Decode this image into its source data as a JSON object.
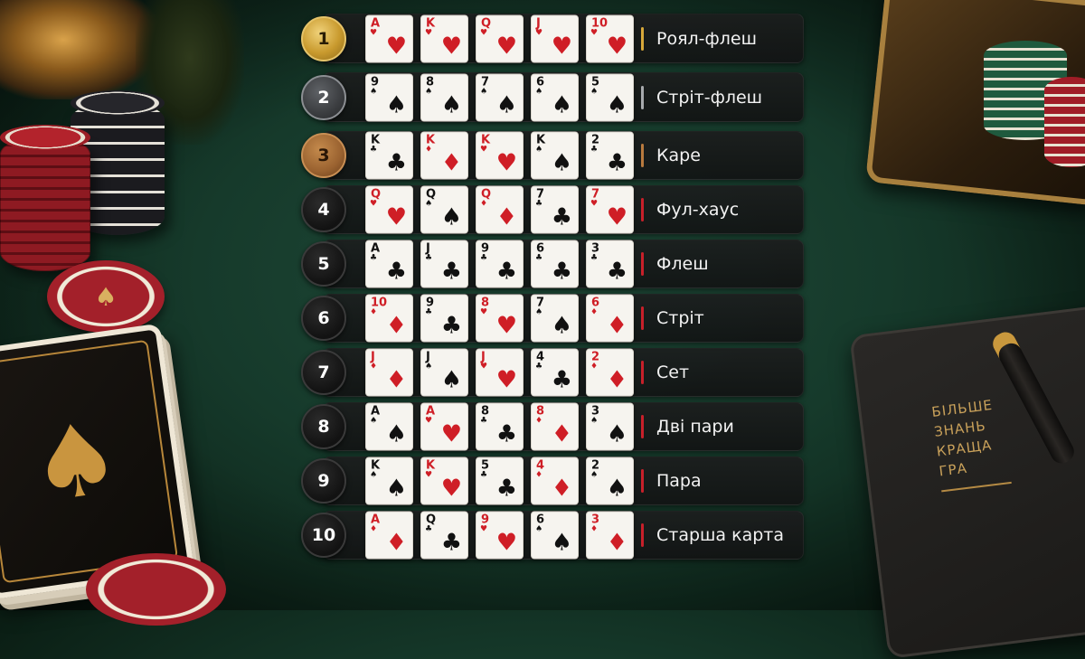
{
  "hands": [
    {
      "rank": "1",
      "medal": "gold",
      "name": "Роял-флеш",
      "cards": [
        {
          "r": "A",
          "s": "♥",
          "c": "red"
        },
        {
          "r": "K",
          "s": "♥",
          "c": "red"
        },
        {
          "r": "Q",
          "s": "♥",
          "c": "red"
        },
        {
          "r": "J",
          "s": "♥",
          "c": "red"
        },
        {
          "r": "10",
          "s": "♥",
          "c": "red"
        }
      ]
    },
    {
      "rank": "2",
      "medal": "silver",
      "name": "Стріт-флеш",
      "cards": [
        {
          "r": "9",
          "s": "♠",
          "c": "black"
        },
        {
          "r": "8",
          "s": "♠",
          "c": "black"
        },
        {
          "r": "7",
          "s": "♠",
          "c": "black"
        },
        {
          "r": "6",
          "s": "♠",
          "c": "black"
        },
        {
          "r": "5",
          "s": "♠",
          "c": "black"
        }
      ]
    },
    {
      "rank": "3",
      "medal": "bronze",
      "name": "Каре",
      "cards": [
        {
          "r": "K",
          "s": "♣",
          "c": "black"
        },
        {
          "r": "K",
          "s": "♦",
          "c": "red"
        },
        {
          "r": "K",
          "s": "♥",
          "c": "red"
        },
        {
          "r": "K",
          "s": "♠",
          "c": "black"
        },
        {
          "r": "2",
          "s": "♣",
          "c": "black"
        }
      ]
    },
    {
      "rank": "4",
      "medal": "",
      "name": "Фул-хаус",
      "cards": [
        {
          "r": "Q",
          "s": "♥",
          "c": "red"
        },
        {
          "r": "Q",
          "s": "♠",
          "c": "black"
        },
        {
          "r": "Q",
          "s": "♦",
          "c": "red"
        },
        {
          "r": "7",
          "s": "♣",
          "c": "black"
        },
        {
          "r": "7",
          "s": "♥",
          "c": "red"
        }
      ]
    },
    {
      "rank": "5",
      "medal": "",
      "name": "Флеш",
      "cards": [
        {
          "r": "A",
          "s": "♣",
          "c": "black"
        },
        {
          "r": "J",
          "s": "♣",
          "c": "black"
        },
        {
          "r": "9",
          "s": "♣",
          "c": "black"
        },
        {
          "r": "6",
          "s": "♣",
          "c": "black"
        },
        {
          "r": "3",
          "s": "♣",
          "c": "black"
        }
      ]
    },
    {
      "rank": "6",
      "medal": "",
      "name": "Стріт",
      "cards": [
        {
          "r": "10",
          "s": "♦",
          "c": "red"
        },
        {
          "r": "9",
          "s": "♣",
          "c": "black"
        },
        {
          "r": "8",
          "s": "♥",
          "c": "red"
        },
        {
          "r": "7",
          "s": "♠",
          "c": "black"
        },
        {
          "r": "6",
          "s": "♦",
          "c": "red"
        }
      ]
    },
    {
      "rank": "7",
      "medal": "",
      "name": "Сет",
      "cards": [
        {
          "r": "J",
          "s": "♦",
          "c": "red"
        },
        {
          "r": "J",
          "s": "♠",
          "c": "black"
        },
        {
          "r": "J",
          "s": "♥",
          "c": "red"
        },
        {
          "r": "4",
          "s": "♣",
          "c": "black"
        },
        {
          "r": "2",
          "s": "♦",
          "c": "red"
        }
      ]
    },
    {
      "rank": "8",
      "medal": "",
      "name": "Дві пари",
      "cards": [
        {
          "r": "A",
          "s": "♠",
          "c": "black"
        },
        {
          "r": "A",
          "s": "♥",
          "c": "red"
        },
        {
          "r": "8",
          "s": "♣",
          "c": "black"
        },
        {
          "r": "8",
          "s": "♦",
          "c": "red"
        },
        {
          "r": "3",
          "s": "♠",
          "c": "black"
        }
      ]
    },
    {
      "rank": "9",
      "medal": "",
      "name": "Пара",
      "cards": [
        {
          "r": "K",
          "s": "♠",
          "c": "black"
        },
        {
          "r": "K",
          "s": "♥",
          "c": "red"
        },
        {
          "r": "5",
          "s": "♣",
          "c": "black"
        },
        {
          "r": "4",
          "s": "♦",
          "c": "red"
        },
        {
          "r": "2",
          "s": "♠",
          "c": "black"
        }
      ]
    },
    {
      "rank": "10",
      "medal": "",
      "name": "Старша карта",
      "cards": [
        {
          "r": "A",
          "s": "♦",
          "c": "red"
        },
        {
          "r": "Q",
          "s": "♣",
          "c": "black"
        },
        {
          "r": "9",
          "s": "♥",
          "c": "red"
        },
        {
          "r": "6",
          "s": "♠",
          "c": "black"
        },
        {
          "r": "3",
          "s": "♦",
          "c": "red"
        }
      ]
    }
  ],
  "notebook": {
    "lines": [
      "БІЛЬШЕ",
      "ЗНАНЬ",
      "КРАЩА",
      "ГРА"
    ]
  },
  "icons": {
    "chip": "spade-icon",
    "deck": "spade-icon"
  },
  "colors": {
    "red_suit": "#cf1e26",
    "black_suit": "#111111",
    "gold": "#d7a83a",
    "silver": "#a7aaad",
    "bronze": "#b87a3e",
    "felt": "#1f4a38"
  }
}
